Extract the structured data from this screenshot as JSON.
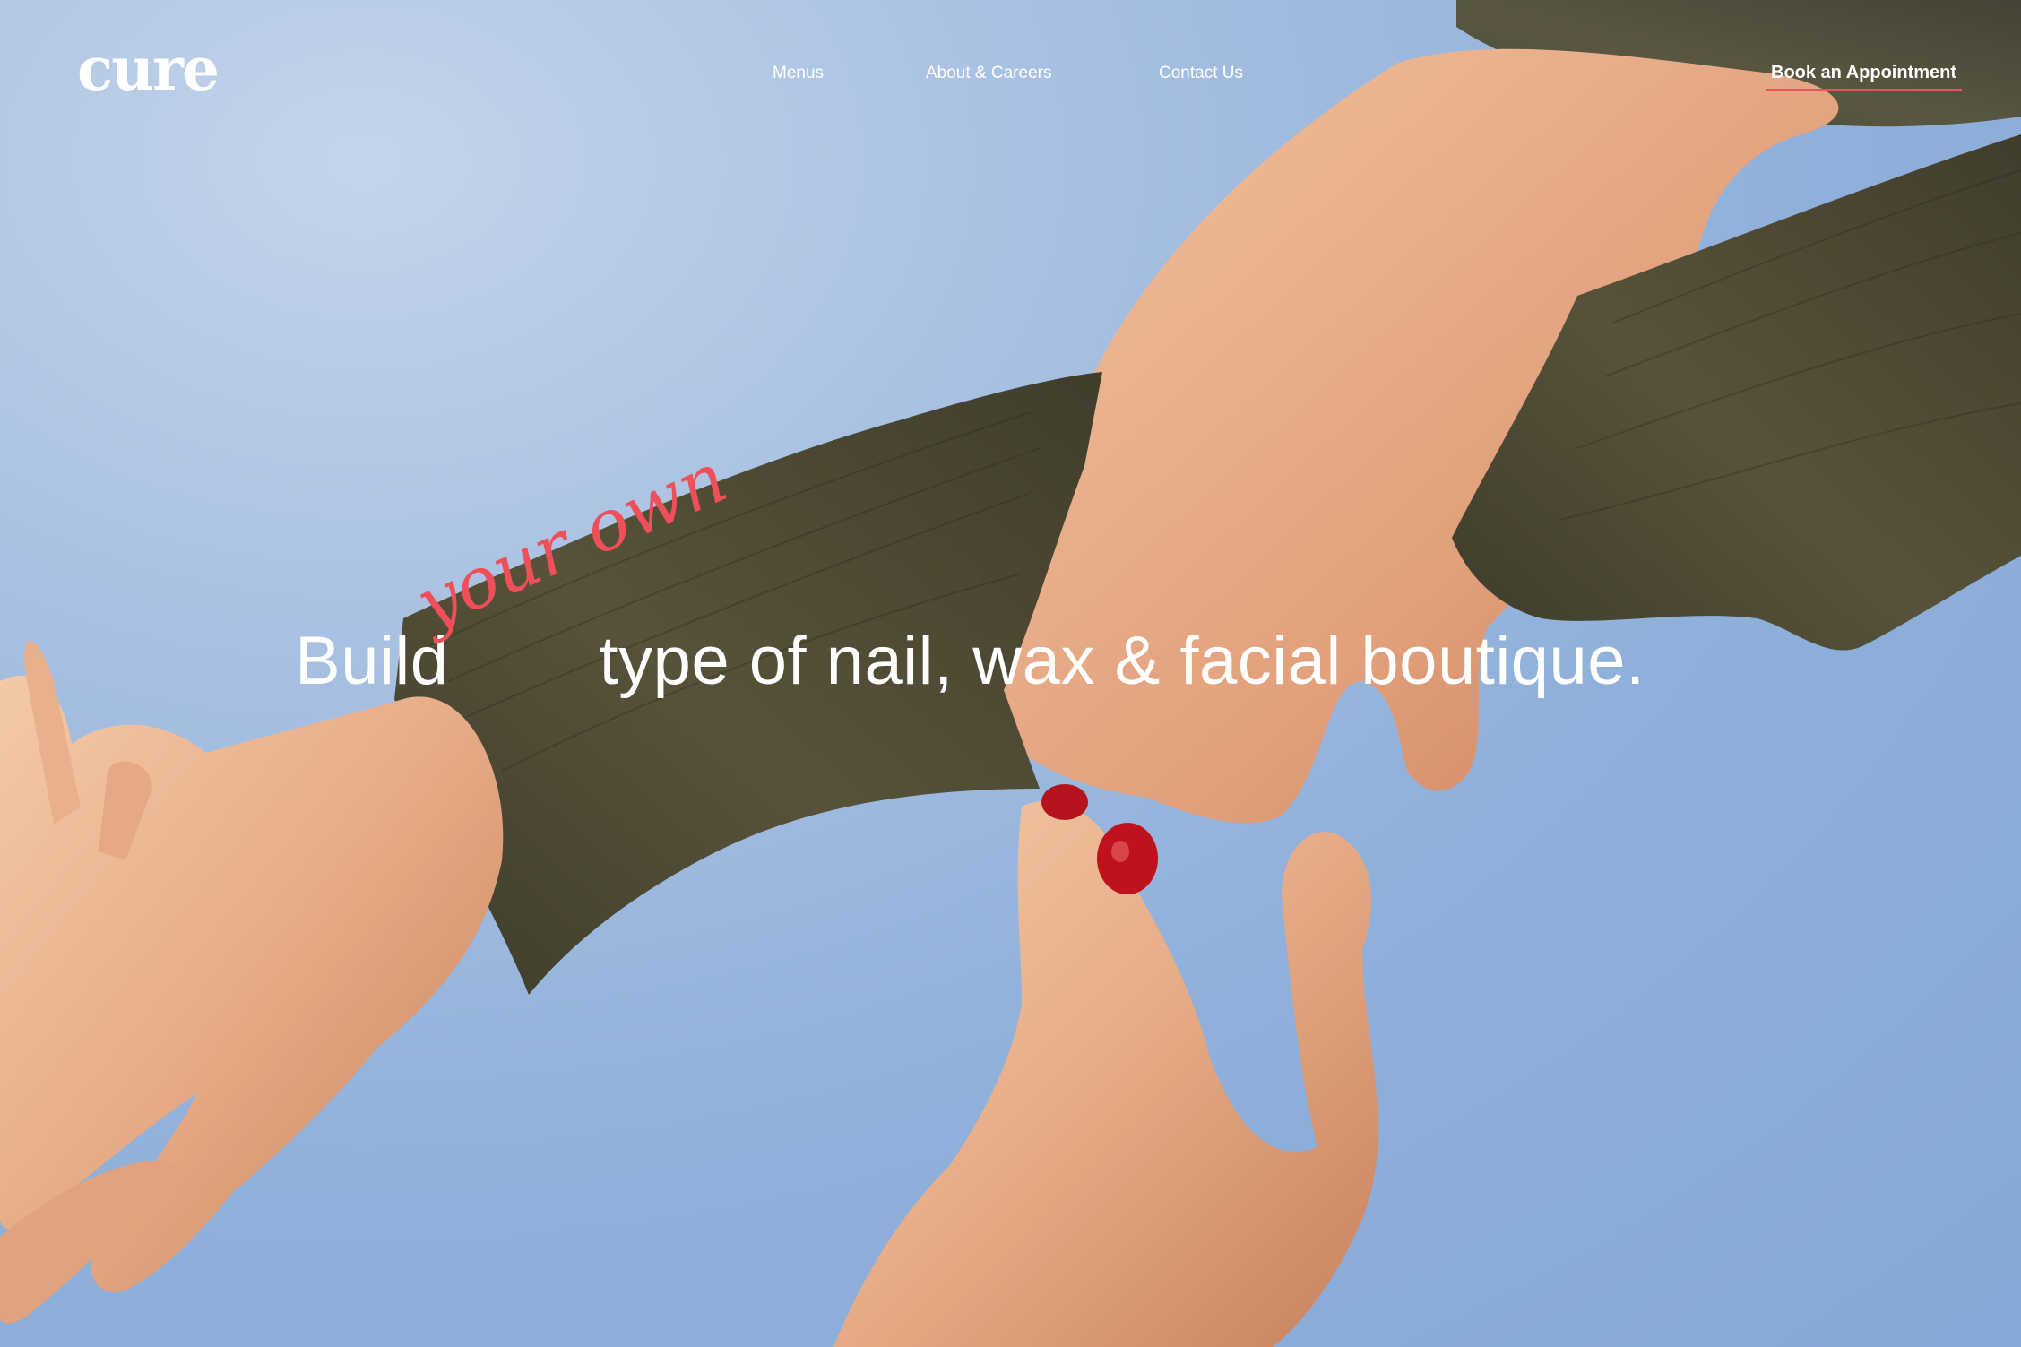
{
  "brand": {
    "logo_text": "cure"
  },
  "nav": {
    "items": [
      {
        "label": "Menus"
      },
      {
        "label": "About & Careers"
      },
      {
        "label": "Contact Us"
      }
    ],
    "cta_label": "Book an Appointment"
  },
  "hero": {
    "headline_start": "Build",
    "headline_script": "your own",
    "headline_end": "type of nail, wax & facial boutique.",
    "image_description_icon": "hands-with-fabric-photo"
  },
  "colors": {
    "accent": "#ef4f58",
    "sky": "#9bb8dd",
    "fabric": "#4e4a36",
    "skin": "#e3a27f"
  }
}
